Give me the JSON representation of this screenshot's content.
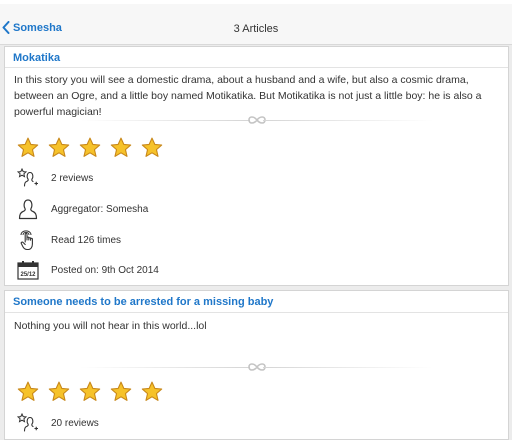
{
  "header": {
    "back_label": "Somesha",
    "title": "3 Articles"
  },
  "articles": [
    {
      "title": "Mokatika",
      "body": "In this story you will see a domestic drama, about a husband and a wife, but also a cosmic drama, between an Ogre, and a little boy named Motikatika. But Motikatika is not just a little boy: he is also a powerful magician!",
      "rating": 5,
      "reviews": "2 reviews",
      "aggregator": "Aggregator: Somesha",
      "read_count": "Read 126 times",
      "posted": "Posted on: 9th Oct 2014",
      "calendar_icon_text": "25/12"
    },
    {
      "title": "Someone needs to be arrested for a missing baby",
      "body": "Nothing you will not hear in this world...lol",
      "rating": 5,
      "reviews": "20 reviews"
    }
  ],
  "colors": {
    "accent": "#1f77c9",
    "star_fill": "#f6c22a",
    "star_stroke": "#c8881a",
    "background": "#ececec"
  },
  "icons": {
    "back": "chevron-left-icon",
    "star": "star-icon",
    "reviews": "review-star-person-icon",
    "aggregator": "person-outline-icon",
    "read": "hand-touch-icon",
    "posted": "calendar-icon",
    "divider": "infinity-ornament-icon"
  }
}
